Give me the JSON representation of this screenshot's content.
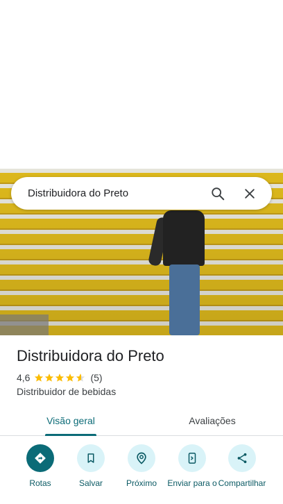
{
  "search": {
    "query": "Distribuidora do Preto"
  },
  "place": {
    "name": "Distribuidora do Preto",
    "rating": "4,6",
    "rating_value": 4.6,
    "review_count": "(5)",
    "category": "Distribuidor de bebidas"
  },
  "tabs": [
    {
      "label": "Visão geral",
      "active": true
    },
    {
      "label": "Avaliações",
      "active": false
    }
  ],
  "actions": [
    {
      "label": "Rotas",
      "icon": "directions-icon"
    },
    {
      "label": "Salvar",
      "icon": "bookmark-icon"
    },
    {
      "label": "Próximo",
      "icon": "nearby-icon"
    },
    {
      "label": "Enviar para o",
      "icon": "send-to-phone-icon"
    },
    {
      "label": "Compartilhar",
      "icon": "share-icon"
    }
  ],
  "colors": {
    "accent": "#0b6b77",
    "action_bg": "#d9f3f8",
    "star": "#fbbc04"
  }
}
